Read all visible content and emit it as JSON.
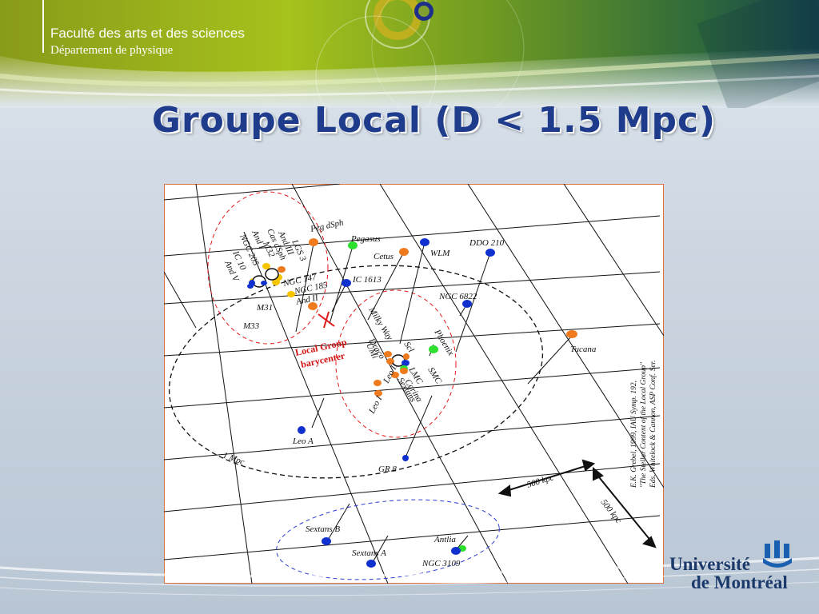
{
  "header": {
    "faculty": "Faculté des arts et des sciences",
    "department": "Département de physique"
  },
  "slide": {
    "title": "Groupe Local (D < 1.5 Mpc)"
  },
  "figure": {
    "galaxies": {
      "peg_dsph": "Peg dSph",
      "pegasus": "Pegasus",
      "lgs3": "LGS 3",
      "and_iii": "And III",
      "cas_dsph": "Cas dSph",
      "and_i": "And I",
      "m32": "M32",
      "ngc205": "NGC 205",
      "ic10": "IC 10",
      "and_v": "And V",
      "ngc147": "NGC 147",
      "ngc185": "NGC 185",
      "and_ii": "And II",
      "m31": "M31",
      "m33": "M33",
      "cetus": "Cetus",
      "wlm": "WLM",
      "ddo210": "DDO 210",
      "ic1613": "IC 1613",
      "ngc6822": "NGC 6822",
      "milky_way": "Milky Way",
      "draco": "Draco",
      "umi": "UMi",
      "scl": "Scl",
      "phoenix": "Phoenix",
      "smc": "SMC",
      "lmc": "LMC",
      "carina": "Carina",
      "sextans": "Sextans",
      "leo_ii": "Leo II",
      "leo_i": "Leo I",
      "tucana": "Tucana",
      "leo_a": "Leo A",
      "gr8": "GR 8",
      "sextans_b": "Sextans B",
      "sextans_a": "Sextans A",
      "antlia": "Antlia",
      "ngc3109": "NGC 3109"
    },
    "annotations": {
      "barycenter_line1": "Local Group",
      "barycenter_line2": "barycenter",
      "radius_label": "1 Mpc",
      "scale_h": "500 kpc",
      "scale_v": "500 kpc"
    },
    "citation": {
      "line1": "E.K. Grebel, 1999, IAU Symp. 192,",
      "line2": "\"The Stellar Content of the Local Group\"",
      "line3": "Eds. Whitelock & Cannon, ASP Conf. Ser."
    },
    "colors": {
      "blue": "#1030d0",
      "orange": "#f07a1e",
      "green": "#2ee02e",
      "yellow": "#f6c500",
      "red": "#e01818"
    }
  },
  "logo": {
    "line1": "Université",
    "line2": "de Montréal"
  }
}
